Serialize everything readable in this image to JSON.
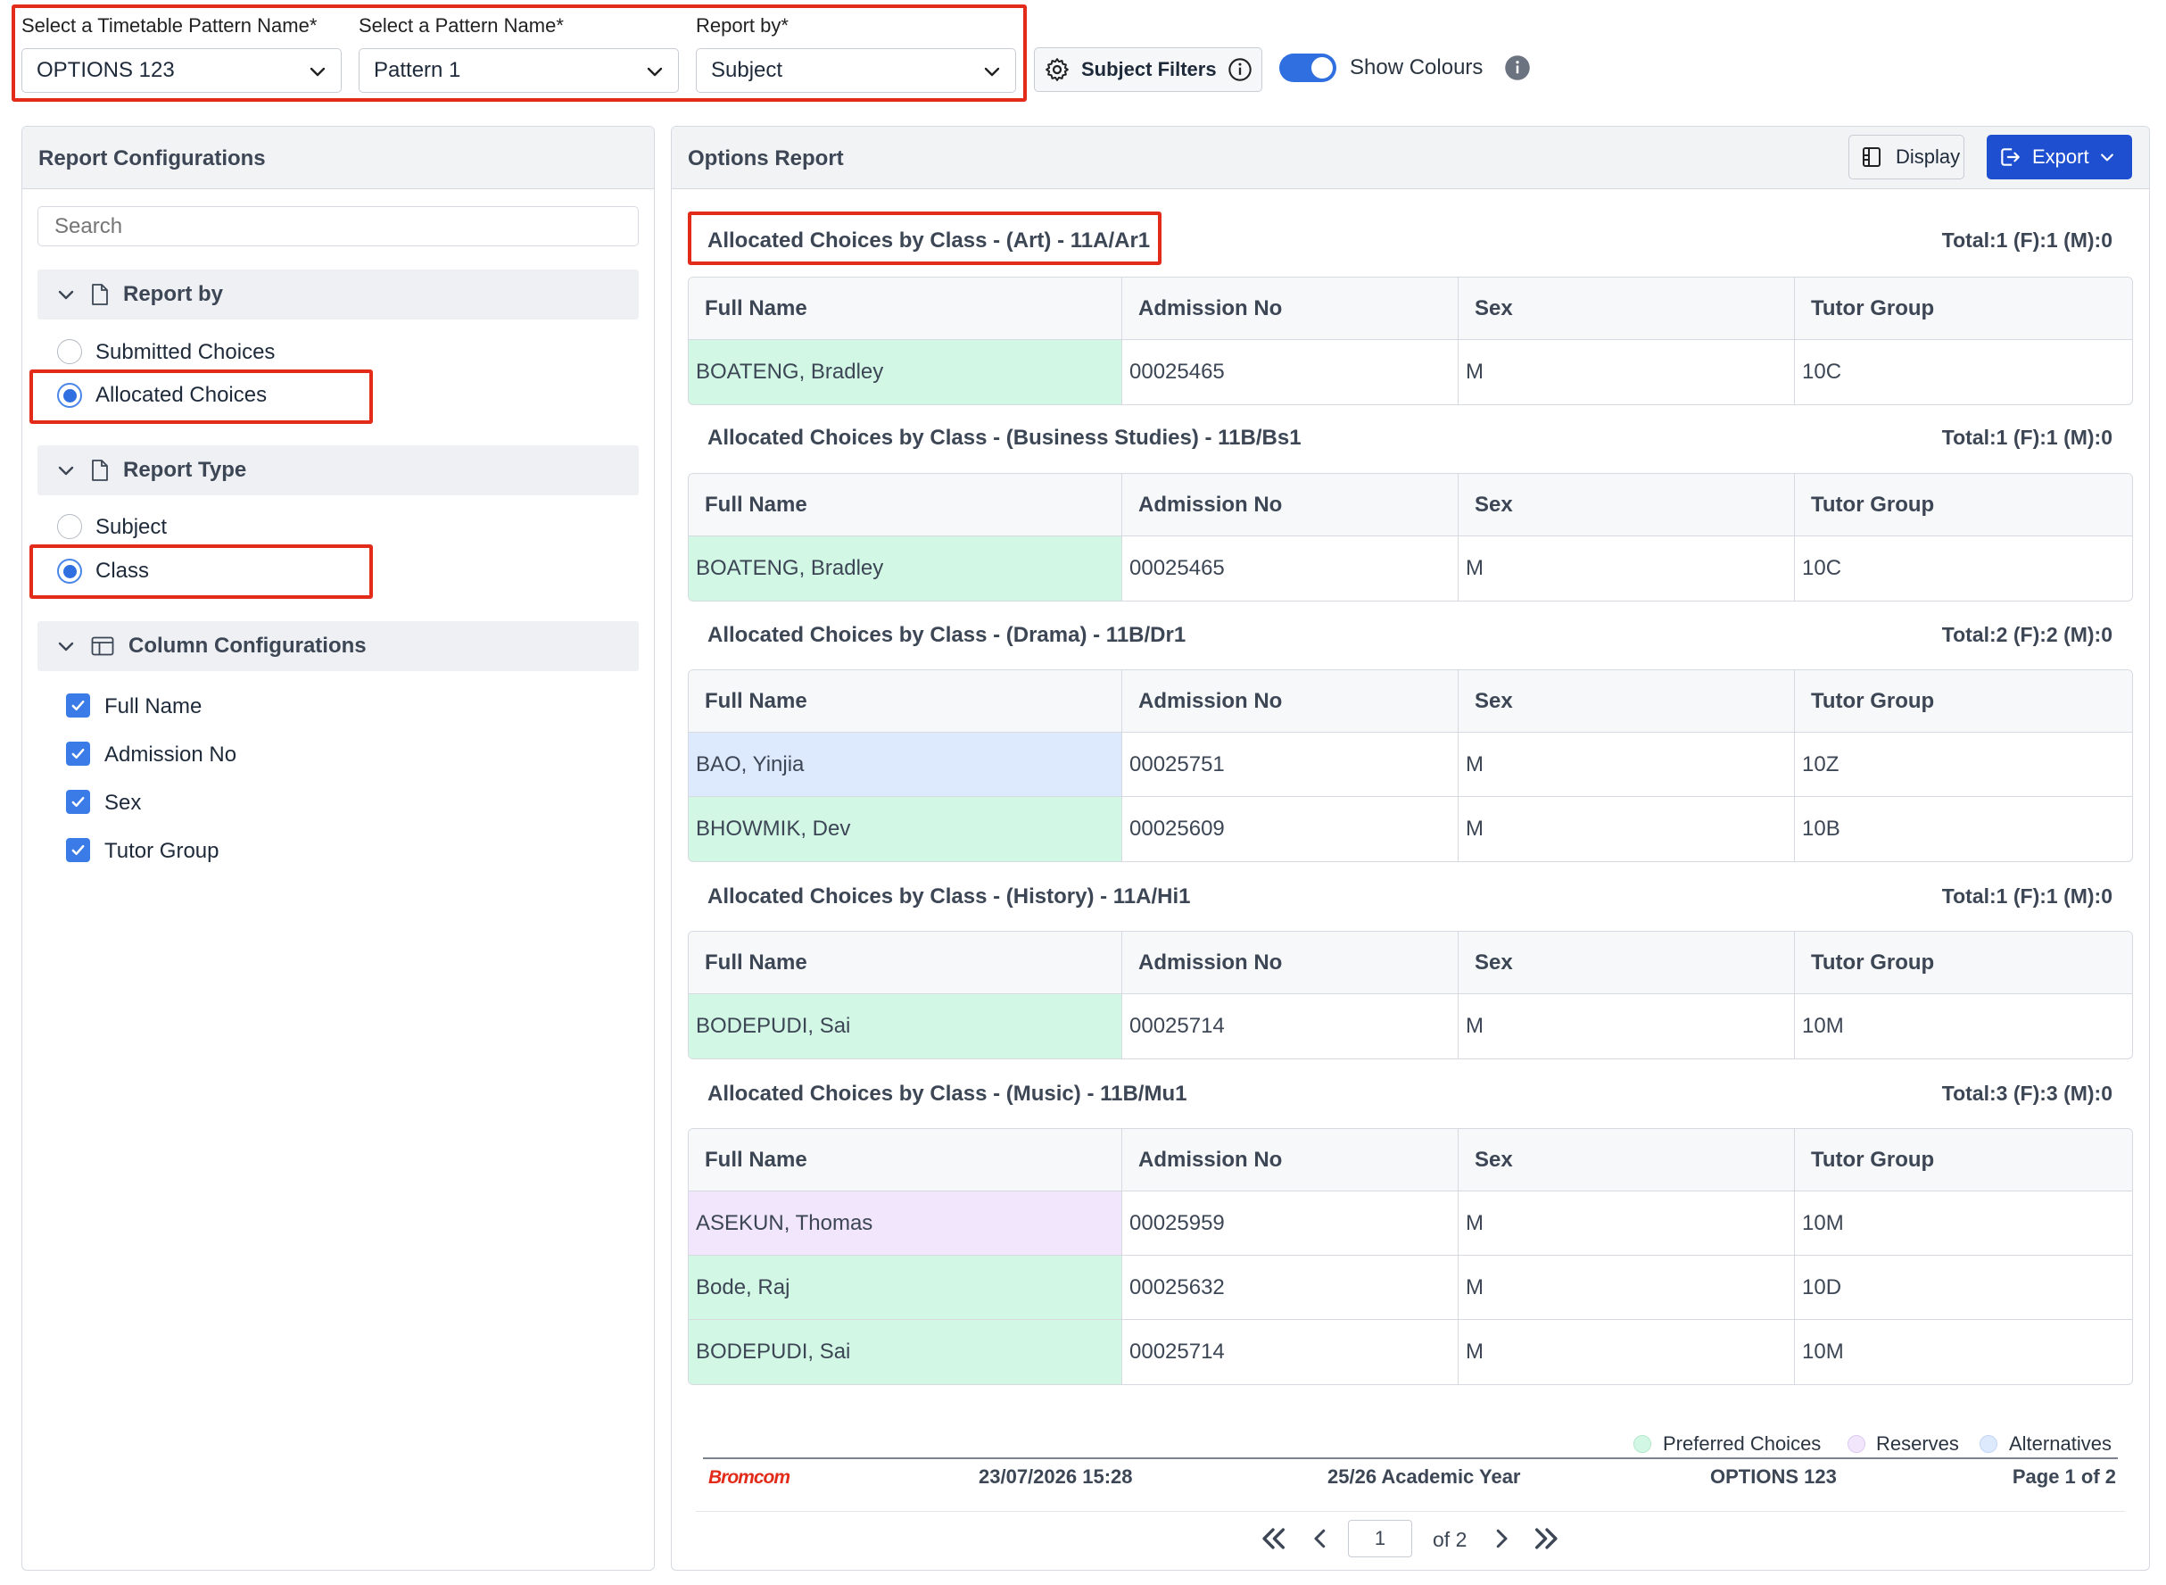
{
  "filters": {
    "timetable_label": "Select a Timetable Pattern Name*",
    "timetable_value": "OPTIONS 123",
    "pattern_label": "Select a Pattern Name*",
    "pattern_value": "Pattern 1",
    "report_by_label": "Report by*",
    "report_by_value": "Subject",
    "subject_filters_label": "Subject Filters",
    "show_colours_label": "Show Colours",
    "show_colours_on": true
  },
  "config": {
    "title": "Report Configurations",
    "search_placeholder": "Search",
    "report_by_title": "Report by",
    "report_by_options": [
      "Submitted Choices",
      "Allocated Choices"
    ],
    "report_by_selected": "Allocated Choices",
    "report_type_title": "Report Type",
    "report_type_options": [
      "Subject",
      "Class"
    ],
    "report_type_selected": "Class",
    "columns_title": "Column Configurations",
    "columns": [
      "Full Name",
      "Admission No",
      "Sex",
      "Tutor Group"
    ]
  },
  "report": {
    "title": "Options Report",
    "display_label": "Display",
    "export_label": "Export",
    "headers": [
      "Full Name",
      "Admission No",
      "Sex",
      "Tutor Group"
    ],
    "sections": [
      {
        "title": "Allocated Choices by Class - (Art) - 11A/Ar1",
        "total": "Total:1 (F):1 (M):0",
        "rows": [
          {
            "name": "BOATENG, Bradley",
            "adm": "00025465",
            "sex": "M",
            "tutor": "10C",
            "type": "pref"
          }
        ]
      },
      {
        "title": "Allocated Choices by Class - (Business Studies) - 11B/Bs1",
        "total": "Total:1 (F):1 (M):0",
        "rows": [
          {
            "name": "BOATENG, Bradley",
            "adm": "00025465",
            "sex": "M",
            "tutor": "10C",
            "type": "pref"
          }
        ]
      },
      {
        "title": "Allocated Choices by Class - (Drama) - 11B/Dr1",
        "total": "Total:2 (F):2 (M):0",
        "rows": [
          {
            "name": "BAO, Yinjia",
            "adm": "00025751",
            "sex": "M",
            "tutor": "10Z",
            "type": "alt"
          },
          {
            "name": "BHOWMIK, Dev",
            "adm": "00025609",
            "sex": "M",
            "tutor": "10B",
            "type": "pref"
          }
        ]
      },
      {
        "title": "Allocated Choices by Class - (History) - 11A/Hi1",
        "total": "Total:1 (F):1 (M):0",
        "rows": [
          {
            "name": "BODEPUDI, Sai",
            "adm": "00025714",
            "sex": "M",
            "tutor": "10M",
            "type": "pref"
          }
        ]
      },
      {
        "title": "Allocated Choices by Class - (Music) - 11B/Mu1",
        "total": "Total:3 (F):3 (M):0",
        "rows": [
          {
            "name": "ASEKUN, Thomas",
            "adm": "00025959",
            "sex": "M",
            "tutor": "10M",
            "type": "res"
          },
          {
            "name": "Bode, Raj",
            "adm": "00025632",
            "sex": "M",
            "tutor": "10D",
            "type": "pref"
          },
          {
            "name": "BODEPUDI, Sai",
            "adm": "00025714",
            "sex": "M",
            "tutor": "10M",
            "type": "pref"
          }
        ]
      }
    ],
    "legend": {
      "preferred": "Preferred Choices",
      "reserves": "Reserves",
      "alternatives": "Alternatives"
    },
    "footer": {
      "brand": "Bromcom",
      "datetime": "23/07/2026 15:28",
      "year": "25/26 Academic Year",
      "pattern": "OPTIONS 123",
      "page": "Page 1 of 2"
    },
    "pager": {
      "current": "1",
      "of_text": "of 2"
    }
  },
  "colors": {
    "preferred": "#d3f7e5",
    "alternatives": "#dde9fc",
    "reserves": "#f1e6fc",
    "accent": "#1f4fd1",
    "highlight": "#e32b1a"
  }
}
